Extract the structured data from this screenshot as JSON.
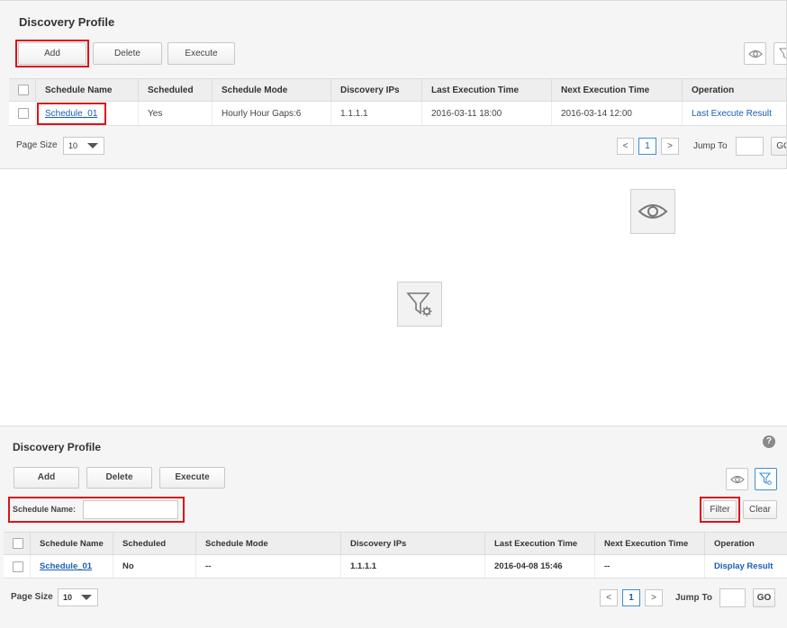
{
  "panel1": {
    "title": "Discovery Profile",
    "buttons": {
      "add": "Add",
      "delete": "Delete",
      "execute": "Execute"
    },
    "table": {
      "headers": [
        "Schedule Name",
        "Scheduled",
        "Schedule Mode",
        "Discovery IPs",
        "Last Execution Time",
        "Next Execution Time",
        "Operation"
      ],
      "rows": [
        {
          "name": "Schedule_01",
          "scheduled": "Yes",
          "mode": "Hourly Hour Gaps:6",
          "ips": "1.1.1.1",
          "last": "2016-03-11 18:00",
          "next": "2016-03-14 12:00",
          "operation": "Last Execute Result"
        }
      ]
    },
    "pagination": {
      "page_size_label": "Page Size",
      "page_size": "10",
      "prev": "<",
      "current": "1",
      "next": ">",
      "jump_to": "Jump To",
      "go": "GO"
    }
  },
  "panel2": {
    "title": "Discovery Profile",
    "buttons": {
      "add": "Add",
      "delete": "Delete",
      "execute": "Execute",
      "filter": "Filter",
      "clear": "Clear"
    },
    "filter": {
      "label": "Schedule Name:",
      "value": ""
    },
    "table": {
      "headers": [
        "Schedule Name",
        "Scheduled",
        "Schedule Mode",
        "Discovery IPs",
        "Last Execution Time",
        "Next Execution Time",
        "Operation"
      ],
      "rows": [
        {
          "name": "Schedule_01",
          "scheduled": "No",
          "mode": "--",
          "ips": "1.1.1.1",
          "last": "2016-04-08 15:46",
          "next": "--",
          "operation": "Display Result"
        }
      ]
    },
    "pagination": {
      "page_size_label": "Page Size",
      "page_size": "10",
      "prev": "<",
      "current": "1",
      "next": ">",
      "jump_to": "Jump To",
      "go": "GO"
    }
  },
  "icons": {
    "eye": "eye-icon",
    "filter": "filter-settings-icon",
    "help": "help-icon"
  },
  "colors": {
    "highlight": "#d9141b",
    "link": "#1a5fb4",
    "accent": "#3a8fd6"
  }
}
